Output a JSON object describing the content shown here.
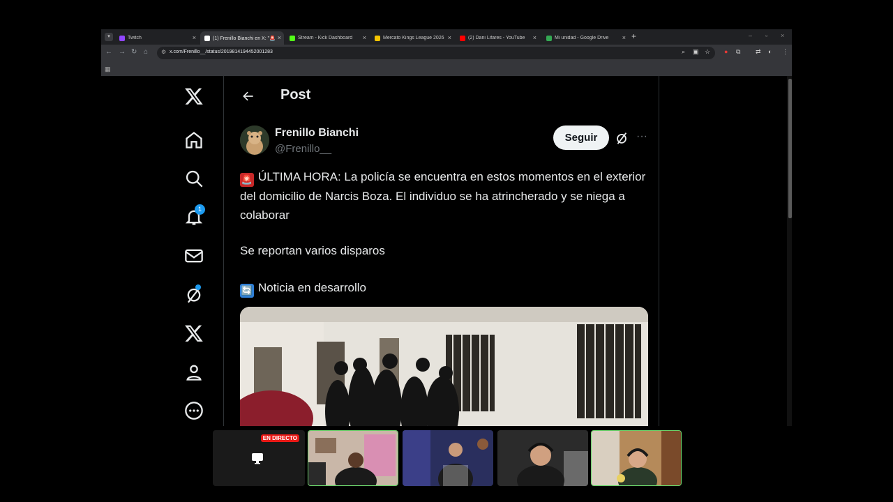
{
  "browser": {
    "tabs": [
      {
        "title": "Twitch",
        "color": "#9146ff",
        "active": false
      },
      {
        "title": "(1) Frenillo Bianchi en X: \"🚨 Ú",
        "color": "#ffffff",
        "active": true
      },
      {
        "title": "Stream - Kick Dashboard",
        "color": "#53fc18",
        "active": false
      },
      {
        "title": "Mercato Kings League 2026 | K",
        "color": "#f5c400",
        "active": false
      },
      {
        "title": "(2) Dani Lifares - YouTube",
        "color": "#ff0000",
        "active": false
      },
      {
        "title": "Mi unidad - Google Drive",
        "color": "#34a853",
        "active": false
      }
    ],
    "url": "x.com/Frenillo__/status/2019814194452001283"
  },
  "nav": {
    "notifications_count": "1"
  },
  "post": {
    "header_title": "Post",
    "author_name": "Frenillo Bianchi",
    "author_handle": "@Frenillo__",
    "follow_label": "Seguir",
    "line1": "ÚLTIMA HORA: La policía se encuentra en estos momentos en el exterior del domicilio de Narcis Boza. El individuo se ha atrincherado y se niega a colaborar",
    "line2": "Se reportan varios disparos",
    "line3": "Noticia en desarrollo",
    "emoji1": "🚨",
    "emoji3": "🔄"
  },
  "stream": {
    "live_label": "EN DIRECTO"
  },
  "colors": {
    "accent": "#1d9bf0",
    "live": "#e91916"
  }
}
